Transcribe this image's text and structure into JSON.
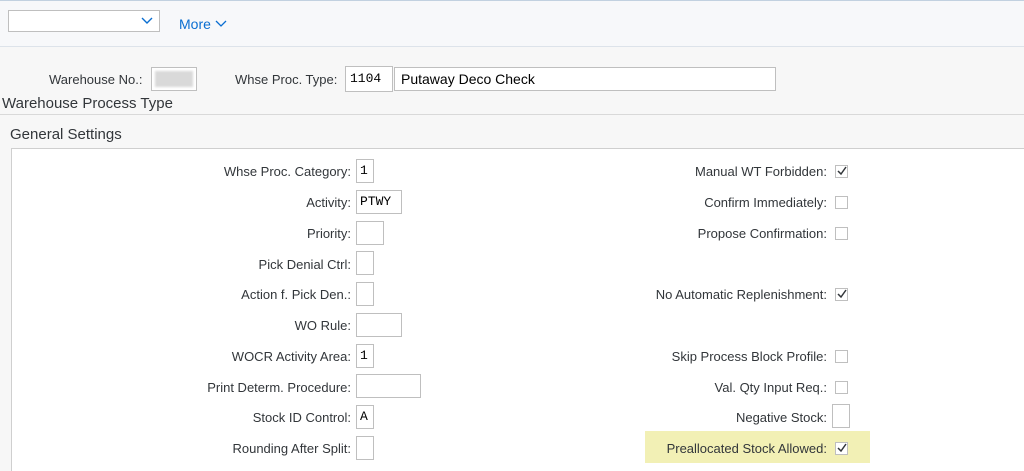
{
  "toolbar": {
    "dropdown_value": "",
    "more_label": "More"
  },
  "header": {
    "warehouse_label": "Warehouse No.:",
    "warehouse_value": "",
    "proc_type_label": "Whse Proc. Type:",
    "proc_type_value": "1104",
    "proc_type_desc": "Putaway Deco Check"
  },
  "section_title": "Warehouse Process Type",
  "group_title": "General Settings",
  "left_fields": [
    {
      "label": "Whse Proc. Category:",
      "value": "1"
    },
    {
      "label": "Activity:",
      "value": "PTWY"
    },
    {
      "label": "Priority:",
      "value": ""
    },
    {
      "label": "Pick Denial Ctrl:",
      "value": ""
    },
    {
      "label": "Action f. Pick Den.:",
      "value": ""
    },
    {
      "label": "WO Rule:",
      "value": ""
    },
    {
      "label": "WOCR Activity Area:",
      "value": "1"
    },
    {
      "label": "Print Determ. Procedure:",
      "value": ""
    },
    {
      "label": "Stock ID Control:",
      "value": "A"
    },
    {
      "label": "Rounding After Split:",
      "value": ""
    }
  ],
  "right_fields": [
    {
      "label": "Manual WT Forbidden:",
      "checked": true
    },
    {
      "label": "Confirm Immediately:",
      "checked": false
    },
    {
      "label": "Propose Confirmation:",
      "checked": false
    },
    {
      "label": "No Automatic Replenishment:",
      "checked": true
    },
    {
      "label": "Skip Process Block Profile:",
      "checked": false
    },
    {
      "label": "Val. Qty Input Req.:",
      "checked": false
    },
    {
      "label": "Negative Stock:",
      "value": ""
    },
    {
      "label": "Preallocated Stock Allowed:",
      "checked": true
    }
  ],
  "colors": {
    "highlight": "#f2f0b5",
    "link": "#0a6ed1"
  }
}
